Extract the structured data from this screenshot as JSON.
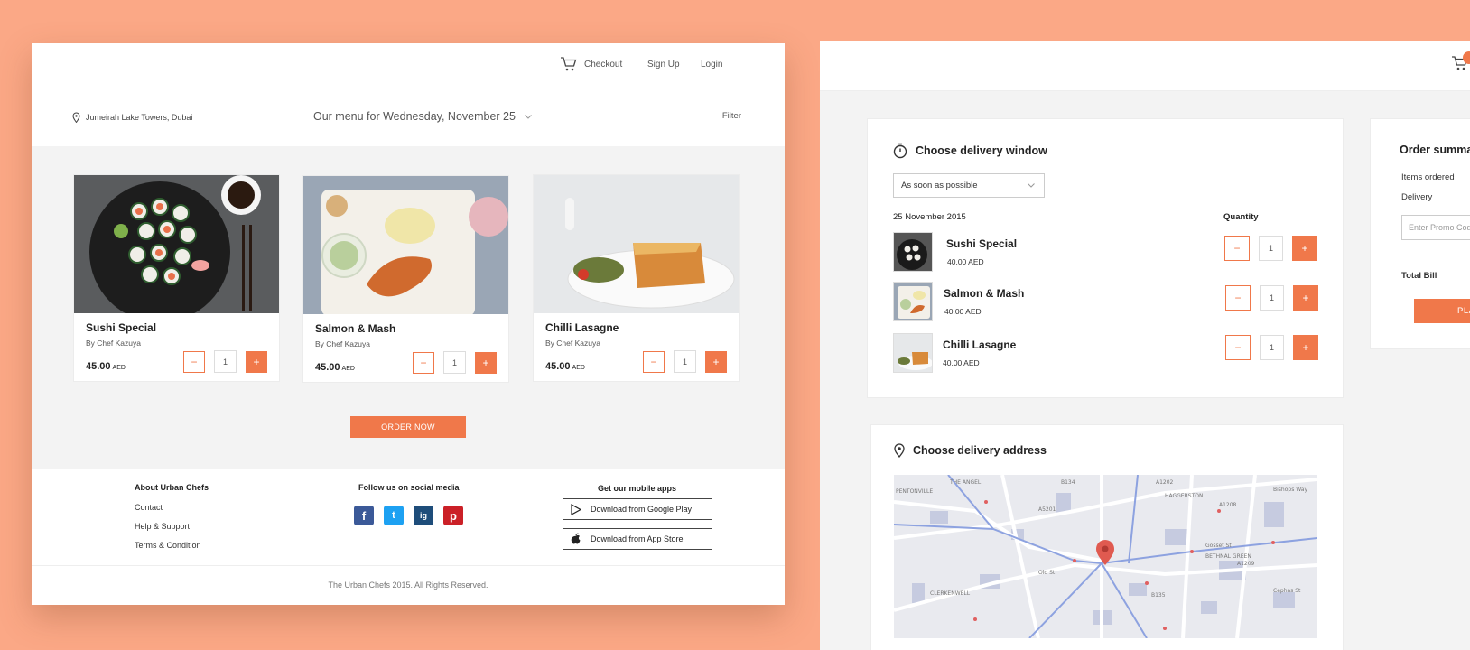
{
  "left": {
    "nav": {
      "checkout": "Checkout",
      "signup": "Sign Up",
      "login": "Login"
    },
    "location": "Jumeirah Lake Towers, Dubai",
    "menu_date": "Our menu for Wednesday, November 25",
    "filter": "Filter",
    "cards": [
      {
        "name": "Sushi Special",
        "chef": "By Chef Kazuya",
        "price": "45.00",
        "currency": "AED",
        "qty": "1"
      },
      {
        "name": "Salmon & Mash",
        "chef": "By Chef Kazuya",
        "price": "45.00",
        "currency": "AED",
        "qty": "1"
      },
      {
        "name": "Chilli Lasagne",
        "chef": "By Chef Kazuya",
        "price": "45.00",
        "currency": "AED",
        "qty": "1"
      }
    ],
    "minus": "−",
    "plus": "+",
    "order_now": "ORDER NOW",
    "footer": {
      "about_title": "About Urban Chefs",
      "links": [
        "Contact",
        "Help & Support",
        "Terms & Condition"
      ],
      "social_title": "Follow us on social media",
      "social": [
        "f",
        "t",
        "ig",
        "p"
      ],
      "apps_title": "Get our mobile apps",
      "google_play": "Download from Google Play",
      "app_store": "Download from App Store",
      "copyright": "The Urban Chefs 2015. All Rights Reserved."
    }
  },
  "right": {
    "delivery_window": {
      "title": "Choose delivery window",
      "select_value": "As soon as possible",
      "date": "25 November 2015",
      "quantity_label": "Quantity",
      "items": [
        {
          "name": "Sushi Special",
          "price": "40.00 AED",
          "qty": "1"
        },
        {
          "name": "Salmon & Mash",
          "price": "40.00 AED",
          "qty": "1"
        },
        {
          "name": "Chilli Lasagne",
          "price": "40.00 AED",
          "qty": "1"
        }
      ]
    },
    "summary": {
      "title": "Order summar",
      "items_ordered": "Items ordered",
      "delivery": "Delivery",
      "promo_placeholder": "Enter Promo Code",
      "total": "Total Bill",
      "place": "PLAC"
    },
    "address": {
      "title": "Choose delivery address"
    },
    "map_labels": [
      "THE ANGEL",
      "PENTONVILLE",
      "HAGGERSTON",
      "BETHNAL GREEN",
      "CLERKENWELL",
      "Bishops Way",
      "Old St",
      "Gosset St",
      "Cephas St",
      "A1208",
      "A1209",
      "B135",
      "B134",
      "A5201",
      "A1202"
    ]
  }
}
